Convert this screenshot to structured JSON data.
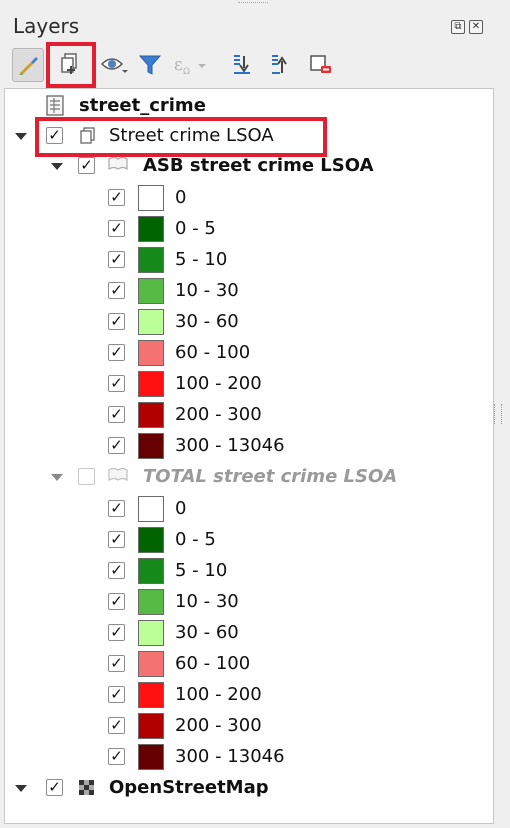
{
  "panel": {
    "title": "Layers",
    "float_glyph": "⧉",
    "close_glyph": "✕"
  },
  "toolbar": {
    "buttons": [
      {
        "name": "style-manager-icon"
      },
      {
        "name": "add-group-icon"
      },
      {
        "name": "visibility-eye-icon"
      },
      {
        "name": "filter-icon"
      },
      {
        "name": "filter-expression-icon"
      },
      {
        "name": "expand-all-icon"
      },
      {
        "name": "collapse-all-icon"
      },
      {
        "name": "remove-layer-icon"
      }
    ]
  },
  "tree": {
    "table_layer": "street_crime",
    "group": "Street crime LSOA",
    "layer1": "ASB street crime LSOA",
    "layer2": "TOTAL street crime LSOA",
    "basemap": "OpenStreetMap",
    "legend1": [
      {
        "label": "0",
        "color": "#ffffff"
      },
      {
        "label": "0 - 5",
        "color": "#006400"
      },
      {
        "label": "5 - 10",
        "color": "#15891a"
      },
      {
        "label": "10 - 30",
        "color": "#55bb44"
      },
      {
        "label": "30 - 60",
        "color": "#bbff99"
      },
      {
        "label": "60 - 100",
        "color": "#f57272"
      },
      {
        "label": "100 - 200",
        "color": "#ff1111"
      },
      {
        "label": "200 - 300",
        "color": "#b00000"
      },
      {
        "label": "300 - 13046",
        "color": "#660000"
      }
    ],
    "legend2": [
      {
        "label": "0",
        "color": "#ffffff"
      },
      {
        "label": "0 - 5",
        "color": "#006400"
      },
      {
        "label": "5 - 10",
        "color": "#15891a"
      },
      {
        "label": "10 - 30",
        "color": "#55bb44"
      },
      {
        "label": "30 - 60",
        "color": "#bbff99"
      },
      {
        "label": "60 - 100",
        "color": "#f57272"
      },
      {
        "label": "100 - 200",
        "color": "#ff1111"
      },
      {
        "label": "200 - 300",
        "color": "#b00000"
      },
      {
        "label": "300 - 13046",
        "color": "#660000"
      }
    ],
    "check_glyph": "✓"
  },
  "colors": {
    "highlight": "#e02030"
  }
}
